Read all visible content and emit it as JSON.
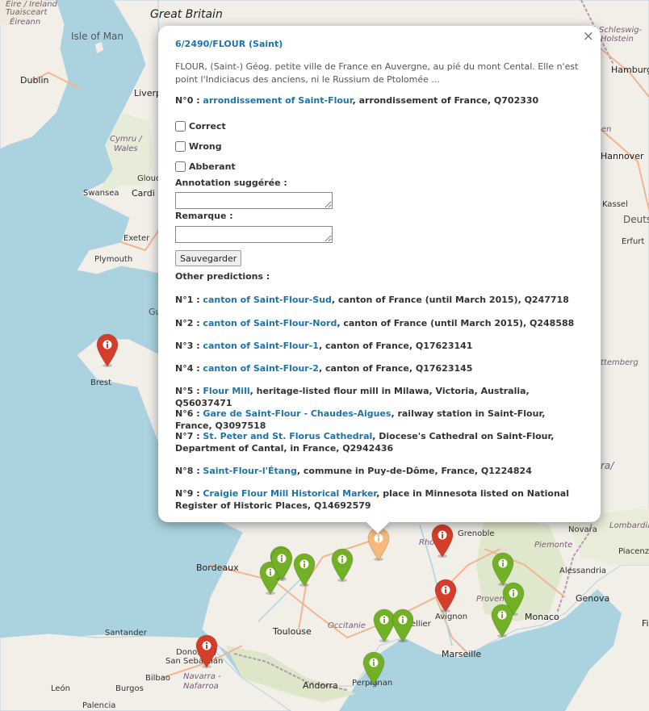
{
  "map": {
    "labels": [
      {
        "name": "label-great-britain",
        "text": "Great Britain"
      },
      {
        "name": "label-eire",
        "text": "Éire / Ireland"
      },
      {
        "name": "label-tuaisceart",
        "text": "Tuaisceart"
      },
      {
        "name": "label-eireann",
        "text": "Éireann"
      },
      {
        "name": "label-isle-of-man",
        "text": "Isle of Man"
      },
      {
        "name": "label-dublin",
        "text": "Dublin"
      },
      {
        "name": "label-liverpool",
        "text": "Liverp"
      },
      {
        "name": "label-cymru",
        "text": "Cymru /"
      },
      {
        "name": "label-wales",
        "text": "Wales"
      },
      {
        "name": "label-glouc",
        "text": "Glouc"
      },
      {
        "name": "label-swansea",
        "text": "Swansea"
      },
      {
        "name": "label-cardiff",
        "text": "Cardi"
      },
      {
        "name": "label-exeter",
        "text": "Exeter"
      },
      {
        "name": "label-plymouth",
        "text": "Plymouth"
      },
      {
        "name": "label-gu",
        "text": "Gu"
      },
      {
        "name": "label-brest",
        "text": "Brest"
      },
      {
        "name": "label-schleswig",
        "text": "Schleswig-"
      },
      {
        "name": "label-holstein",
        "text": "Holstein"
      },
      {
        "name": "label-hamburg",
        "text": "Hamburg"
      },
      {
        "name": "label-en",
        "text": "en"
      },
      {
        "name": "label-hannover",
        "text": "Hannover"
      },
      {
        "name": "label-kassel",
        "text": "Kassel"
      },
      {
        "name": "label-deuts",
        "text": "Deuts"
      },
      {
        "name": "label-erfurt",
        "text": "Erfurt"
      },
      {
        "name": "label-tembe",
        "text": "ttemberg"
      },
      {
        "name": "label-ra",
        "text": "ra/"
      },
      {
        "name": "label-bordeaux",
        "text": "Bordeaux"
      },
      {
        "name": "label-santander",
        "text": "Santander"
      },
      {
        "name": "label-donostia",
        "text": "Donostia /"
      },
      {
        "name": "label-sansebastian",
        "text": "San Sebastián"
      },
      {
        "name": "label-bilbao",
        "text": "Bilbao"
      },
      {
        "name": "label-navarra",
        "text": "Navarra -"
      },
      {
        "name": "label-nafarroa",
        "text": "Nafarroa"
      },
      {
        "name": "label-leon",
        "text": "León"
      },
      {
        "name": "label-burgos",
        "text": "Burgos"
      },
      {
        "name": "label-palencia",
        "text": "Palencia"
      },
      {
        "name": "label-toulouse",
        "text": "Toulouse"
      },
      {
        "name": "label-occitanie",
        "text": "Occitanie"
      },
      {
        "name": "label-andorra",
        "text": "Andorra"
      },
      {
        "name": "label-perpignan",
        "text": "Perpignan"
      },
      {
        "name": "label-marseille",
        "text": "Marseille"
      },
      {
        "name": "label-avignon",
        "text": "Avignon"
      },
      {
        "name": "label-grenoble",
        "text": "Grenoble"
      },
      {
        "name": "label-lyon",
        "text": "Rhône"
      },
      {
        "name": "label-provence",
        "text": "Provence"
      },
      {
        "name": "label-monaco",
        "text": "Monaco"
      },
      {
        "name": "label-novara",
        "text": "Novara"
      },
      {
        "name": "label-lombardia",
        "text": "Lombardia"
      },
      {
        "name": "label-piemonte",
        "text": "Piemonte"
      },
      {
        "name": "label-piacenza",
        "text": "Piacenza"
      },
      {
        "name": "label-alessandria",
        "text": "Alessandria"
      },
      {
        "name": "label-genova",
        "text": "Genova"
      },
      {
        "name": "label-fi",
        "text": "Fi"
      },
      {
        "name": "label-ellier",
        "text": "ellier"
      }
    ],
    "markers": [
      {
        "color": "#d33d29"
      },
      {
        "color": "#f5b97c"
      },
      {
        "color": "#d33d29"
      },
      {
        "color": "#d33d29"
      },
      {
        "color": "#d33d29"
      },
      {
        "color": "#72b026"
      },
      {
        "color": "#72b026"
      },
      {
        "color": "#72b026"
      },
      {
        "color": "#72b026"
      },
      {
        "color": "#72b026"
      },
      {
        "color": "#72b026"
      },
      {
        "color": "#72b026"
      },
      {
        "color": "#72b026"
      },
      {
        "color": "#72b026"
      },
      {
        "color": "#72b026"
      },
      {
        "color": "#72b026"
      }
    ]
  },
  "popup": {
    "title": "6/2490/FLOUR (Saint)",
    "description": "FLOUR, (Saint-) Géog. petite ville de France en Auvergne, au pié du mont Cental. Elle n'est point l'Indiciacus des anciens, ni le Russium de Ptolomée ...",
    "top_prediction": {
      "prefix": "N°0 : ",
      "link": "arrondissement of Saint-Flour",
      "rest": ", arrondissement of France, Q702330"
    },
    "checkboxes": [
      {
        "label": "Correct"
      },
      {
        "label": "Wrong"
      },
      {
        "label": "Abberant"
      }
    ],
    "annotation_label": "Annotation suggérée :",
    "remark_label": "Remarque :",
    "save_label": "Sauvegarder",
    "other_label": "Other predictions :",
    "close_symbol": "×",
    "predictions": [
      {
        "prefix": "N°1 : ",
        "link": "canton of Saint-Flour-Sud",
        "rest": ", canton of France (until March 2015), Q247718"
      },
      {
        "prefix": "N°2 : ",
        "link": "canton of Saint-Flour-Nord",
        "rest": ", canton of France (until March 2015), Q248588"
      },
      {
        "prefix": "N°3 : ",
        "link": "canton of Saint-Flour-1",
        "rest": ", canton of France, Q17623141"
      },
      {
        "prefix": "N°4 : ",
        "link": "canton of Saint-Flour-2",
        "rest": ", canton of France, Q17623145"
      },
      {
        "prefix": "N°5 : ",
        "link": "Flour Mill",
        "rest": ", heritage-listed flour mill in Milawa, Victoria, Australia, Q56037471"
      },
      {
        "prefix": "N°6 : ",
        "link": "Gare de Saint-Flour - Chaudes-Aigues",
        "rest": ", railway station in Saint-Flour, France, Q3097518"
      },
      {
        "prefix": "N°7 : ",
        "link": "St. Peter and St. Florus Cathedral",
        "rest": ", Diocese's Cathedral on Saint-Flour, Department of Cantal, in France, Q2942436"
      },
      {
        "prefix": "N°8 : ",
        "link": "Saint-Flour-l'Étang",
        "rest": ", commune in Puy-de-Dôme, France, Q1224824"
      },
      {
        "prefix": "N°9 : ",
        "link": "Craigie Flour Mill Historical Marker",
        "rest": ", place in Minnesota listed on National Register of Historic Places, Q14692579"
      }
    ]
  }
}
